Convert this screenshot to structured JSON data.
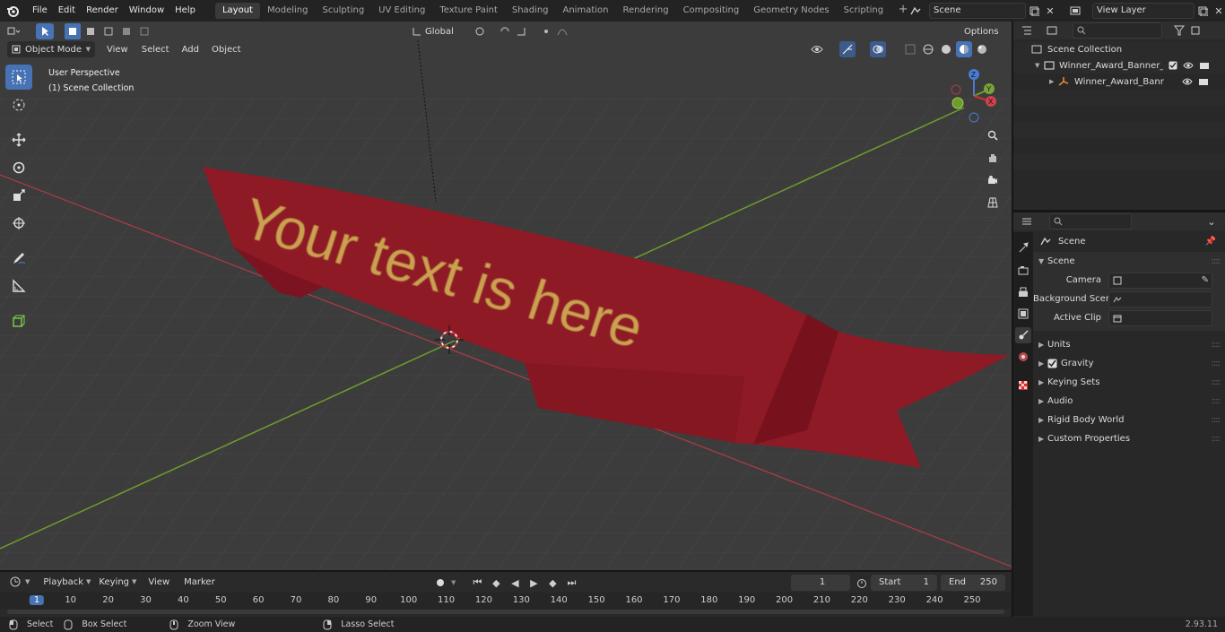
{
  "topbar": {
    "menus": [
      "File",
      "Edit",
      "Render",
      "Window",
      "Help"
    ],
    "workspaces": [
      "Layout",
      "Modeling",
      "Sculpting",
      "UV Editing",
      "Texture Paint",
      "Shading",
      "Animation",
      "Rendering",
      "Compositing",
      "Geometry Nodes",
      "Scripting"
    ],
    "active_workspace": "Layout",
    "scene_field": "Scene",
    "view_layer_field": "View Layer"
  },
  "viewport_header": {
    "mode": "Object Mode",
    "menus": [
      "View",
      "Select",
      "Add",
      "Object"
    ],
    "orientation": "Global",
    "options": "Options"
  },
  "viewport": {
    "perspective_label": "User Perspective",
    "collection_label": "(1) Scene Collection",
    "banner_text": "Your text is here",
    "gizmo_axes": {
      "x": "X",
      "y": "Y",
      "z": "Z"
    }
  },
  "outliner": {
    "root": "Scene Collection",
    "items": [
      {
        "label": "Winner_Award_Banner_Red_I"
      },
      {
        "label": "Winner_Award_Banner_R"
      }
    ]
  },
  "properties": {
    "header": "Scene",
    "panel": "Scene",
    "fields": [
      {
        "label": "Camera",
        "value": ""
      },
      {
        "label": "Background Scene",
        "value": ""
      },
      {
        "label": "Active Clip",
        "value": ""
      }
    ],
    "subpanels": [
      "Units",
      "Gravity",
      "Keying Sets",
      "Audio",
      "Rigid Body World",
      "Custom Properties"
    ]
  },
  "timeline": {
    "menus": [
      "Playback",
      "Keying",
      "View",
      "Marker"
    ],
    "current_frame": "1",
    "start_label": "Start",
    "start_value": "1",
    "end_label": "End",
    "end_value": "250",
    "ruler": [
      "1",
      "10",
      "20",
      "30",
      "40",
      "50",
      "60",
      "70",
      "80",
      "90",
      "100",
      "110",
      "120",
      "130",
      "140",
      "150",
      "160",
      "170",
      "180",
      "190",
      "200",
      "210",
      "220",
      "230",
      "240",
      "250"
    ]
  },
  "statusbar": {
    "hints": [
      "Select",
      "Box Select",
      "Zoom View",
      "Lasso Select"
    ],
    "version": "2.93.11"
  },
  "colors": {
    "accent": "#4772b3",
    "banner_red": "#8e1a26",
    "banner_text": "#c9a24f",
    "x_axis": "#b23b45",
    "y_axis": "#6e9c2e"
  }
}
